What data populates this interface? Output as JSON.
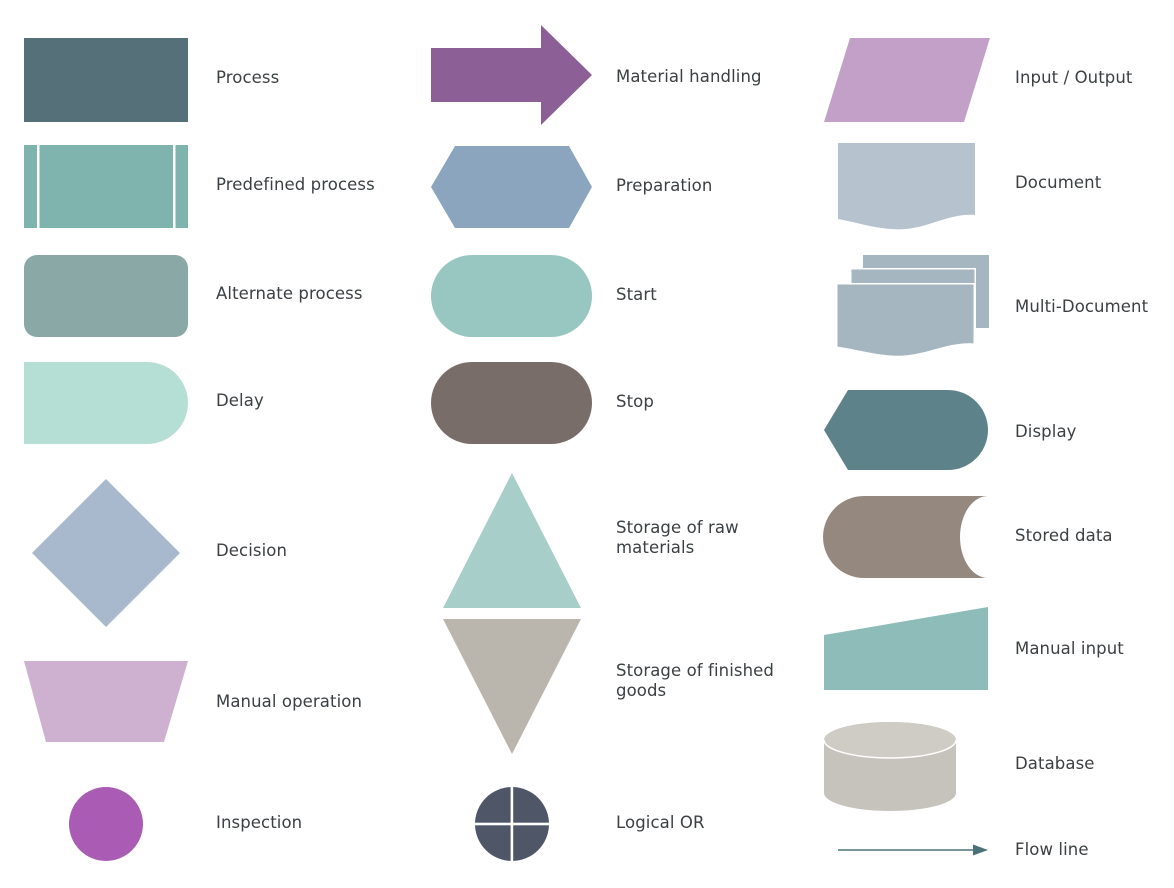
{
  "page": {
    "title": "Flowchart symbols legend",
    "background": "#ffffff",
    "label_color": "#3c4043"
  },
  "columns": [
    {
      "name": "left-column",
      "items": [
        {
          "key": "process",
          "label": "Process",
          "shape": "rectangle",
          "color": "#56707a"
        },
        {
          "key": "predefined-process",
          "label": "Predefined process",
          "shape": "predefined-rectangle",
          "color": "#7fb3ad"
        },
        {
          "key": "alternate-process",
          "label": "Alternate process",
          "shape": "rounded-rectangle",
          "color": "#8aa8a5"
        },
        {
          "key": "delay",
          "label": "Delay",
          "shape": "half-rounded-right",
          "color": "#b5ded4"
        },
        {
          "key": "decision",
          "label": "Decision",
          "shape": "diamond",
          "color": "#a8b8cd"
        },
        {
          "key": "manual-operation",
          "label": "Manual operation",
          "shape": "inverted-trapezoid",
          "color": "#ceb0d0"
        },
        {
          "key": "inspection",
          "label": "Inspection",
          "shape": "circle",
          "color": "#aa5cb4"
        }
      ]
    },
    {
      "name": "middle-column",
      "items": [
        {
          "key": "material-handling",
          "label": "Material handling",
          "shape": "right-arrow",
          "color": "#8c5f96"
        },
        {
          "key": "preparation",
          "label": "Preparation",
          "shape": "hexagon",
          "color": "#8ba5bf"
        },
        {
          "key": "start",
          "label": "Start",
          "shape": "stadium",
          "color": "#98c6c0"
        },
        {
          "key": "stop",
          "label": "Stop",
          "shape": "stadium",
          "color": "#786d69"
        },
        {
          "key": "storage-raw-materials",
          "label": "Storage of raw\nmaterials",
          "shape": "triangle-up",
          "color": "#a8cec9"
        },
        {
          "key": "storage-finished-goods",
          "label": "Storage of finished\n goods",
          "shape": "triangle-down",
          "color": "#bab6ad"
        },
        {
          "key": "logical-or",
          "label": "Logical OR",
          "shape": "circle-cross",
          "color": "#4f5668"
        }
      ]
    },
    {
      "name": "right-column",
      "items": [
        {
          "key": "input-output",
          "label": "Input / Output",
          "shape": "parallelogram",
          "color": "#c3a0c8"
        },
        {
          "key": "document",
          "label": "Document",
          "shape": "document",
          "color": "#b7c2cf"
        },
        {
          "key": "multi-document",
          "label": "Multi-Document",
          "shape": "multi-document",
          "color": "#a5b6c1"
        },
        {
          "key": "display",
          "label": "Display",
          "shape": "display",
          "color": "#5e8289"
        },
        {
          "key": "stored-data",
          "label": "Stored data",
          "shape": "stored-data",
          "color": "#95897f"
        },
        {
          "key": "manual-input",
          "label": "Manual input",
          "shape": "manual-input",
          "color": "#8ebcb8"
        },
        {
          "key": "database",
          "label": "Database",
          "shape": "database",
          "color": "#c6c3bc"
        },
        {
          "key": "flow-line",
          "label": "Flow line",
          "shape": "arrow-line",
          "color": "#4a7078"
        }
      ]
    }
  ]
}
